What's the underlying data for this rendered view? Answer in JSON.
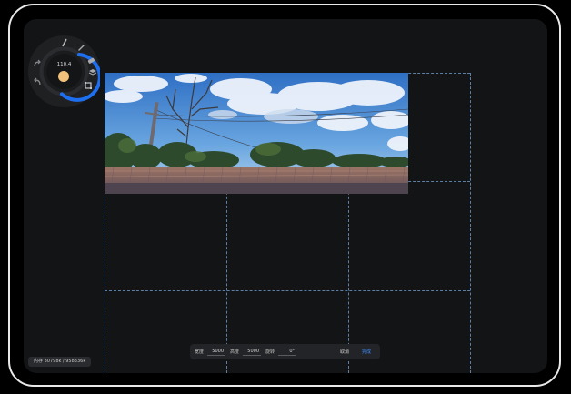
{
  "tool_wheel": {
    "brush_size": "110.4",
    "brush_color": "#f2c27a",
    "accent_color": "#1e6ff0",
    "icons": [
      "redo-icon",
      "undo-icon",
      "brush-icon",
      "smudge-icon",
      "eraser-icon",
      "layers-icon",
      "transform-icon"
    ]
  },
  "status": {
    "memory_text": "内存 30798k / 958336k"
  },
  "canvas_size_bar": {
    "width_label": "宽度",
    "width_value": "5000",
    "height_label": "高度",
    "height_value": "5000",
    "rotate_label": "旋转",
    "rotate_value": "0°",
    "cancel_label": "取消",
    "done_label": "完成"
  },
  "colors": {
    "background": "#131416",
    "frame": "#e9e9e9",
    "guide": "#5d7fa6",
    "done": "#3c8cff"
  }
}
